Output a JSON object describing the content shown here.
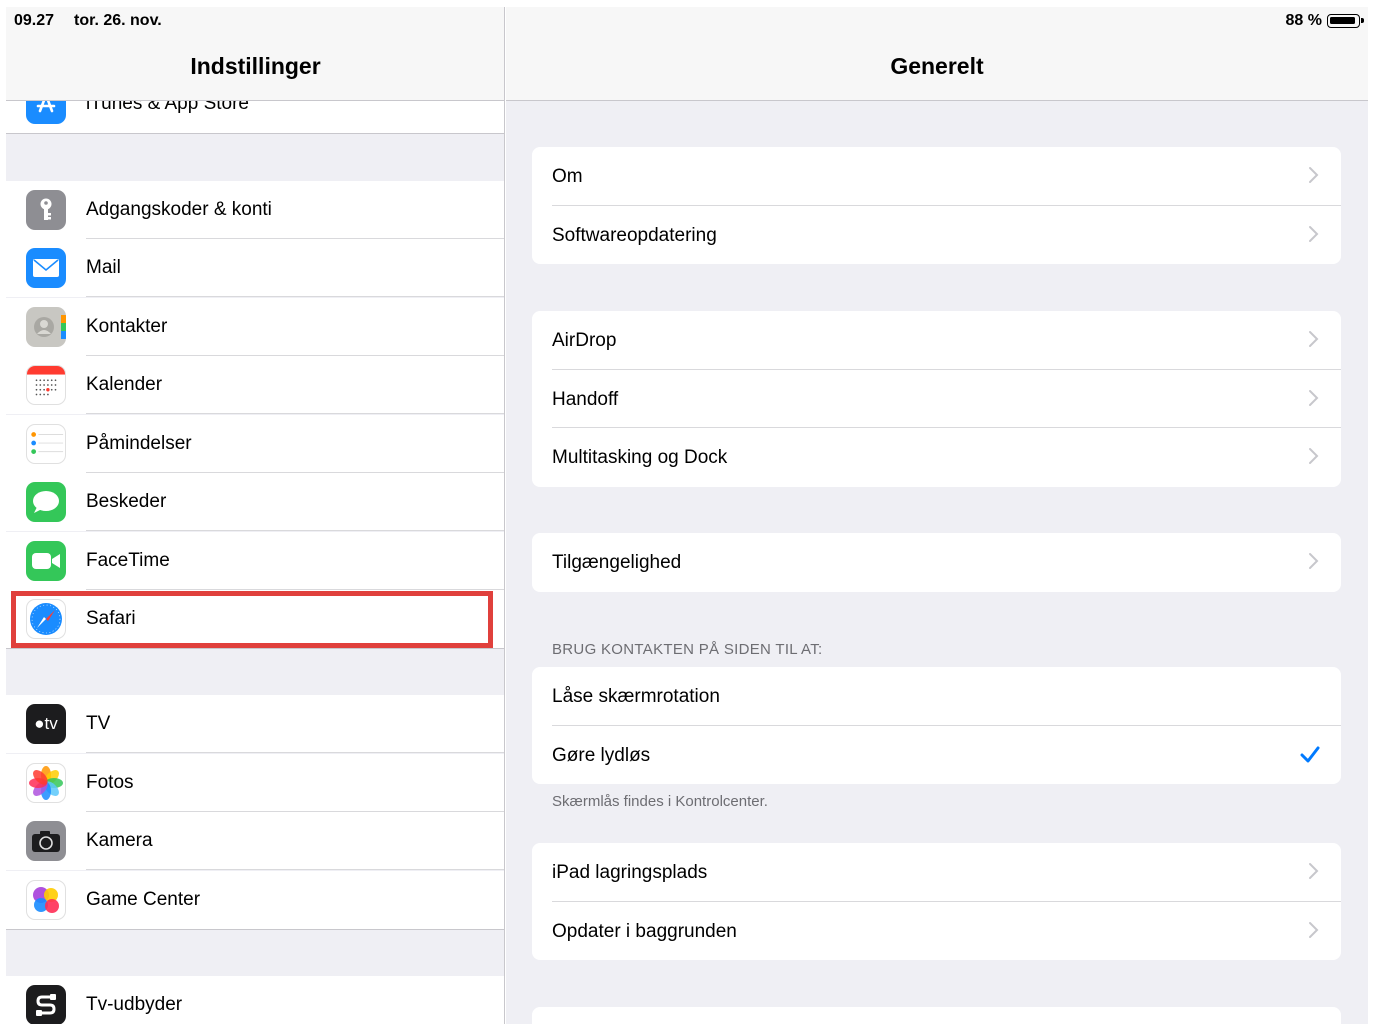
{
  "status_bar": {
    "time": "09.27",
    "date": "tor. 26. nov.",
    "battery": "88 %",
    "battery_level_percent": 88
  },
  "sidebar": {
    "title": "Indstillinger",
    "partial_item": {
      "label": "iTunes & App Store",
      "icon": "app-store-icon",
      "color": "#1a8cff"
    },
    "group1": [
      {
        "label": "Adgangskoder & konti",
        "icon": "key-icon",
        "color": "#8e8e93"
      },
      {
        "label": "Mail",
        "icon": "mail-icon",
        "color": "#1a8cff"
      },
      {
        "label": "Kontakter",
        "icon": "contacts-icon",
        "color": "#c8c7c2"
      },
      {
        "label": "Kalender",
        "icon": "calendar-icon",
        "color": "#ffffff"
      },
      {
        "label": "Påmindelser",
        "icon": "reminders-icon",
        "color": "#ffffff"
      },
      {
        "label": "Beskeder",
        "icon": "messages-icon",
        "color": "#34c759"
      },
      {
        "label": "FaceTime",
        "icon": "facetime-icon",
        "color": "#34c759"
      },
      {
        "label": "Safari",
        "icon": "safari-icon",
        "color": "#1a8cff",
        "highlighted": true
      }
    ],
    "group2": [
      {
        "label": "TV",
        "icon": "tv-icon",
        "color": "#1c1c1e",
        "icon_text": "tv"
      },
      {
        "label": "Fotos",
        "icon": "photos-icon",
        "color": "#ffffff"
      },
      {
        "label": "Kamera",
        "icon": "camera-icon",
        "color": "#8e8e93"
      },
      {
        "label": "Game Center",
        "icon": "game-center-icon",
        "color": "#ffffff"
      }
    ],
    "group3": [
      {
        "label": "Tv-udbyder",
        "icon": "tv-provider-icon",
        "color": "#1c1c1e"
      }
    ]
  },
  "detail": {
    "title": "Generelt",
    "card1": [
      {
        "label": "Om"
      },
      {
        "label": "Softwareopdatering"
      }
    ],
    "card2": [
      {
        "label": "AirDrop"
      },
      {
        "label": "Handoff"
      },
      {
        "label": "Multitasking og Dock"
      }
    ],
    "card3": [
      {
        "label": "Tilgængelighed"
      }
    ],
    "side_switch_header": "BRUG KONTAKTEN PÅ SIDEN TIL AT:",
    "card4": [
      {
        "label": "Låse skærmrotation",
        "checked": false
      },
      {
        "label": "Gøre lydløs",
        "checked": true
      }
    ],
    "side_switch_footer": "Skærmlås findes i Kontrolcenter.",
    "card5": [
      {
        "label": "iPad lagringsplads"
      },
      {
        "label": "Opdater i baggrunden"
      }
    ]
  },
  "colors": {
    "accent": "#007aff",
    "highlight_border": "#e0403c",
    "background_grouped": "#efeff4"
  }
}
